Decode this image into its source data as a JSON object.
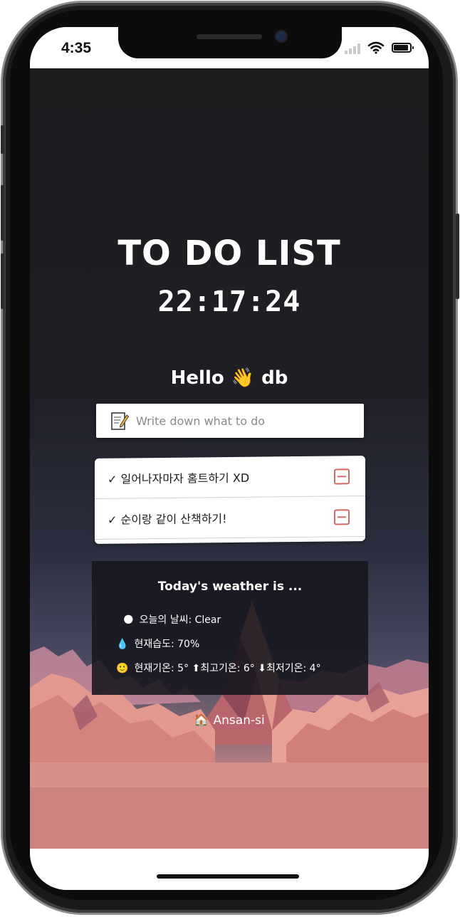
{
  "status_bar": {
    "time": "4:35",
    "signal_icon": "signal-bars-icon",
    "wifi_icon": "wifi-icon",
    "battery_icon": "battery-icon"
  },
  "app": {
    "title": "TO DO LIST",
    "clock": "22:17:24",
    "greeting": {
      "prefix": "Hello",
      "emoji": "👋",
      "name": "db"
    },
    "input": {
      "icon": "memo-icon",
      "placeholder": "Write down what to do",
      "value": ""
    },
    "todos": [
      {
        "text": "✓ 일어나자마자 홈트하기 XD",
        "delete_icon": "minus-square-icon"
      },
      {
        "text": "✓ 순이랑 같이 산책하기!",
        "delete_icon": "minus-square-icon"
      }
    ],
    "weather": {
      "title": "Today's weather is ...",
      "condition": {
        "icon": "🌑",
        "text": "오늘의 날씨: Clear"
      },
      "humidity": {
        "icon": "💧",
        "text": "현재습도: 70%"
      },
      "temperature": {
        "icon": "🙂",
        "text": "현재기온: 5° ⬆최고기온: 6° ⬇최저기온: 4°"
      }
    },
    "location": {
      "icon": "🏠",
      "text": "Ansan-si"
    }
  },
  "colors": {
    "background_top": "#1d1d20",
    "background_bottom": "#cf8482",
    "delete_accent": "#d46767"
  }
}
